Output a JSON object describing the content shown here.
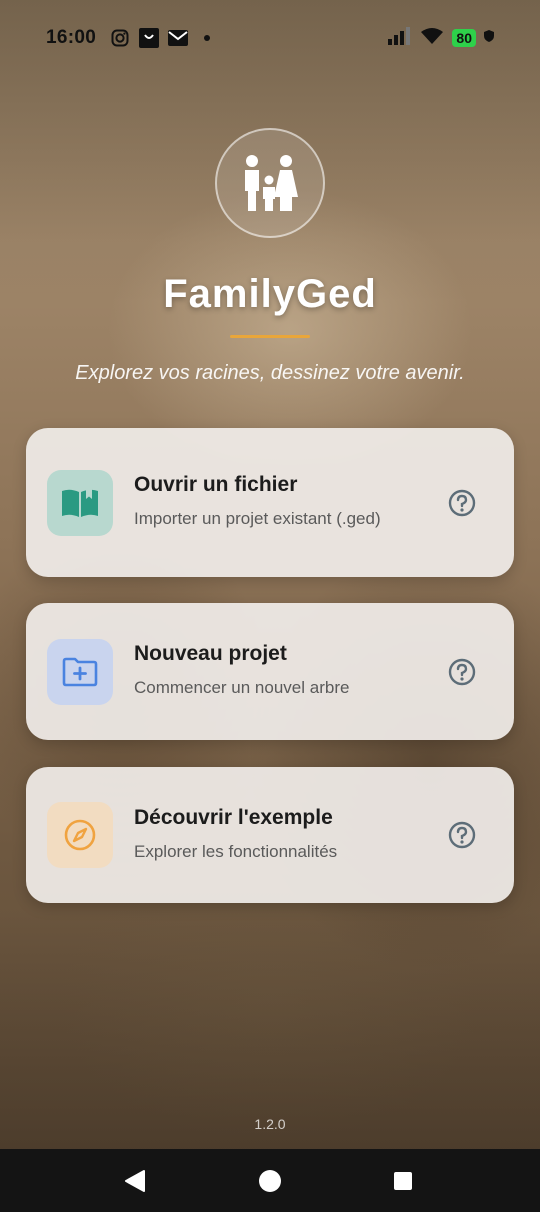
{
  "status_bar": {
    "time": "16:00",
    "left_icons": [
      "instagram-icon",
      "shopping-bag-icon",
      "mail-icon",
      "dot-icon"
    ],
    "right_icons": [
      "signal-icon",
      "wifi-icon"
    ],
    "battery": "80"
  },
  "header": {
    "logo_icon": "family-icon",
    "title": "FamilyGed",
    "tagline": "Explorez vos racines, dessinez votre avenir.",
    "accent": "#e9a63a"
  },
  "cards": [
    {
      "title": "Ouvrir un fichier",
      "subtitle": "Importer un projet existant (.ged)",
      "icon": "open-book-icon",
      "icon_bg": "#b8d8cf",
      "icon_color": "#2a9a82"
    },
    {
      "title": "Nouveau projet",
      "subtitle": "Commencer un nouvel arbre",
      "icon": "add-folder-icon",
      "icon_bg": "#c9d4ee",
      "icon_color": "#4a83e0"
    },
    {
      "title": "Découvrir l'exemple",
      "subtitle": "Explorer les fonctionnalités",
      "icon": "compass-icon",
      "icon_bg": "#f2dcc1",
      "icon_color": "#f0a340"
    }
  ],
  "help_icon": "help-circle-icon",
  "version": "1.2.0",
  "nav_bar": {
    "buttons": [
      "back-icon",
      "home-icon",
      "recents-icon"
    ]
  }
}
